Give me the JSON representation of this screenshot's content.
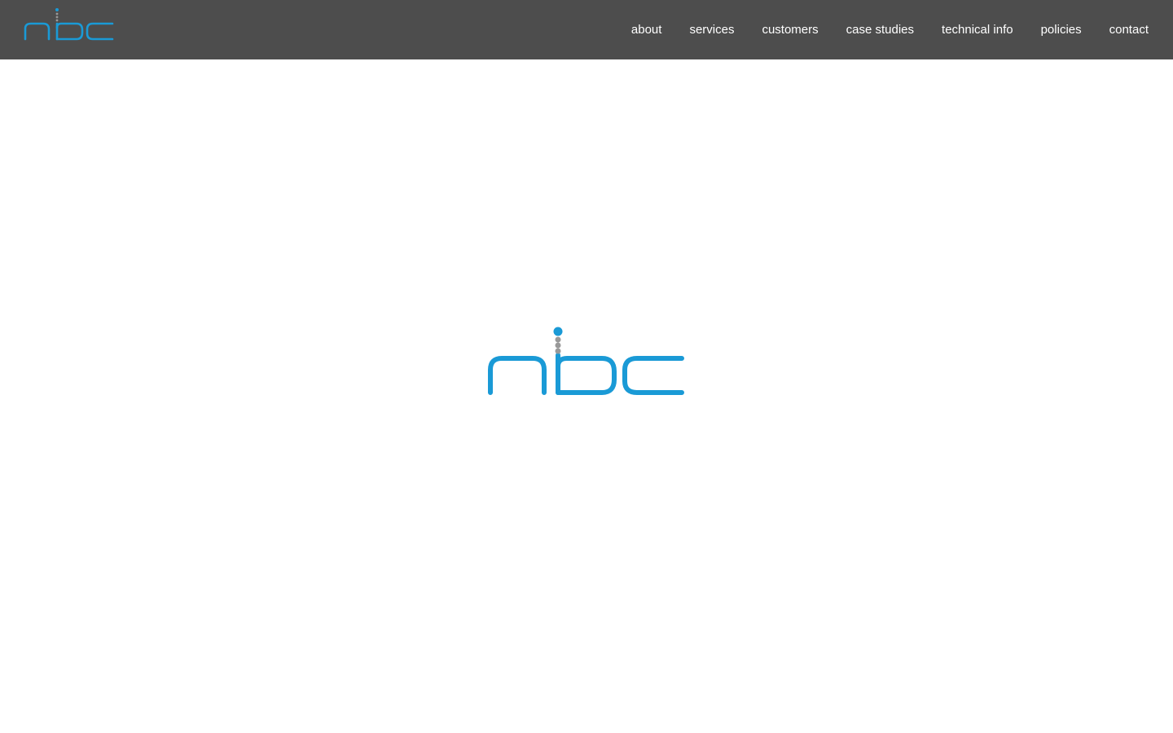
{
  "header": {
    "logo_text": "nbc",
    "nav": [
      {
        "label": "about"
      },
      {
        "label": "services"
      },
      {
        "label": "customers"
      },
      {
        "label": "case studies"
      },
      {
        "label": "technical info"
      },
      {
        "label": "policies"
      },
      {
        "label": "contact"
      }
    ]
  },
  "hero": {
    "logo_text": "nbc"
  },
  "colors": {
    "header_bg": "#4d4d4d",
    "brand_blue": "#1a9ad6",
    "dot_grey": "#999999",
    "nav_text": "#ffffff",
    "page_bg": "#ffffff"
  }
}
